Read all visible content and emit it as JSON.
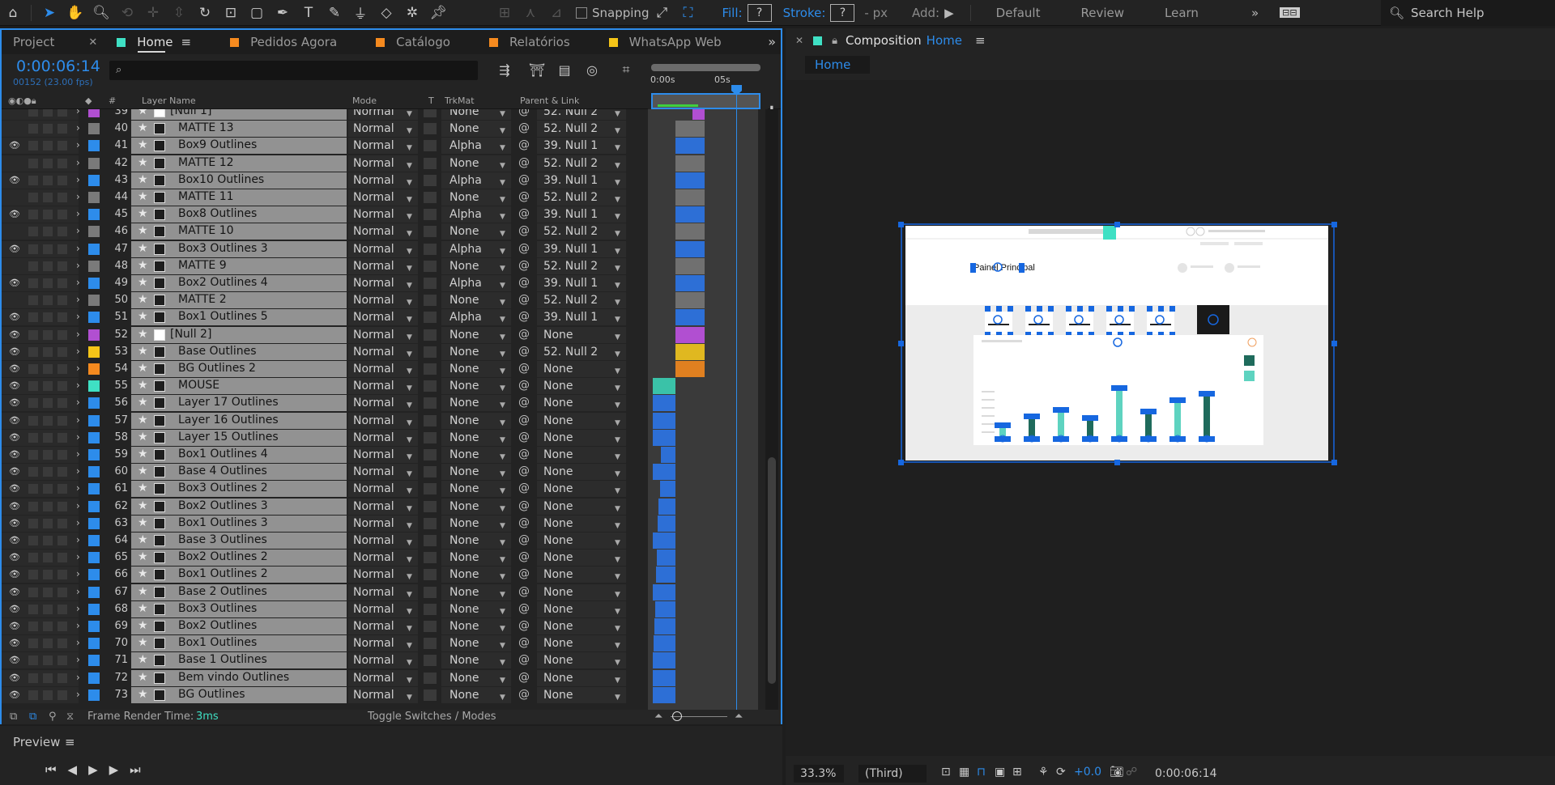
{
  "toolbar": {
    "snapping_label": "Snapping",
    "fill_label": "Fill:",
    "fill_value": "?",
    "stroke_label": "Stroke:",
    "stroke_value": "?",
    "stroke_unit": "- px",
    "add_label": "Add:",
    "workspaces": [
      "Default",
      "Review",
      "Learn"
    ],
    "search_placeholder": "Search Help"
  },
  "tabs": {
    "project": "Project",
    "home": "Home",
    "others": [
      {
        "label": "Pedidos Agora",
        "color": "#f58a1f"
      },
      {
        "label": "Catálogo",
        "color": "#f58a1f"
      },
      {
        "label": "Relatórios",
        "color": "#f58a1f"
      },
      {
        "label": "WhatsApp Web",
        "color": "#f5c518"
      }
    ],
    "home_color": "#3fe0c4"
  },
  "timeline": {
    "timecode": "0:00:06:14",
    "frames": "00152 (23.00 fps)",
    "ruler_start": "0:00s",
    "ruler_mark": "05s",
    "columns": {
      "name": "Layer Name",
      "mode": "Mode",
      "t": "T",
      "trkmat": "TrkMat",
      "parent": "Parent & Link",
      "num": "#"
    }
  },
  "layers": [
    {
      "num": "39",
      "name": "[Null 1]",
      "type": "null",
      "color": "#b14fd1",
      "mode": "Normal",
      "trk": "None",
      "parent": "52. Null 2",
      "eye": false,
      "bar": [
        55,
        70,
        "#b14fd1"
      ]
    },
    {
      "num": "40",
      "name": "MATTE 13",
      "type": "matte",
      "color": "#7a7a7a",
      "mode": "Normal",
      "trk": "None",
      "parent": "52. Null 2",
      "eye": false,
      "bar": [
        34,
        70,
        "#707070"
      ]
    },
    {
      "num": "41",
      "name": "Box9 Outlines",
      "type": "shape",
      "color": "#2d8ceb",
      "mode": "Normal",
      "trk": "Alpha",
      "parent": "39. Null 1",
      "eye": true,
      "bar": [
        34,
        70,
        "#2d6fd6"
      ]
    },
    {
      "num": "42",
      "name": "MATTE 12",
      "type": "matte",
      "color": "#7a7a7a",
      "mode": "Normal",
      "trk": "None",
      "parent": "52. Null 2",
      "eye": false,
      "bar": [
        34,
        70,
        "#707070"
      ]
    },
    {
      "num": "43",
      "name": "Box10 Outlines",
      "type": "shape",
      "color": "#2d8ceb",
      "mode": "Normal",
      "trk": "Alpha",
      "parent": "39. Null 1",
      "eye": true,
      "bar": [
        34,
        70,
        "#2d6fd6"
      ]
    },
    {
      "num": "44",
      "name": "MATTE 11",
      "type": "matte",
      "color": "#7a7a7a",
      "mode": "Normal",
      "trk": "None",
      "parent": "52. Null 2",
      "eye": false,
      "bar": [
        34,
        70,
        "#707070"
      ]
    },
    {
      "num": "45",
      "name": "Box8 Outlines",
      "type": "shape",
      "color": "#2d8ceb",
      "mode": "Normal",
      "trk": "Alpha",
      "parent": "39. Null 1",
      "eye": true,
      "bar": [
        34,
        70,
        "#2d6fd6"
      ]
    },
    {
      "num": "46",
      "name": "MATTE 10",
      "type": "matte",
      "color": "#7a7a7a",
      "mode": "Normal",
      "trk": "None",
      "parent": "52. Null 2",
      "eye": false,
      "bar": [
        34,
        70,
        "#707070"
      ]
    },
    {
      "num": "47",
      "name": "Box3 Outlines 3",
      "type": "shape",
      "color": "#2d8ceb",
      "mode": "Normal",
      "trk": "Alpha",
      "parent": "39. Null 1",
      "eye": true,
      "bar": [
        34,
        70,
        "#2d6fd6"
      ]
    },
    {
      "num": "48",
      "name": "MATTE 9",
      "type": "matte",
      "color": "#7a7a7a",
      "mode": "Normal",
      "trk": "None",
      "parent": "52. Null 2",
      "eye": false,
      "bar": [
        34,
        70,
        "#707070"
      ]
    },
    {
      "num": "49",
      "name": "Box2 Outlines 4",
      "type": "shape",
      "color": "#2d8ceb",
      "mode": "Normal",
      "trk": "Alpha",
      "parent": "39. Null 1",
      "eye": true,
      "bar": [
        34,
        70,
        "#2d6fd6"
      ]
    },
    {
      "num": "50",
      "name": "MATTE 2",
      "type": "matte",
      "color": "#7a7a7a",
      "mode": "Normal",
      "trk": "None",
      "parent": "52. Null 2",
      "eye": false,
      "bar": [
        34,
        70,
        "#707070"
      ]
    },
    {
      "num": "51",
      "name": "Box1 Outlines 5",
      "type": "shape",
      "color": "#2d8ceb",
      "mode": "Normal",
      "trk": "Alpha",
      "parent": "39. Null 1",
      "eye": true,
      "bar": [
        34,
        70,
        "#2d6fd6"
      ]
    },
    {
      "num": "52",
      "name": "[Null 2]",
      "type": "null",
      "color": "#b14fd1",
      "mode": "Normal",
      "trk": "None",
      "parent": "None",
      "eye": true,
      "bar": [
        34,
        70,
        "#b14fd1"
      ]
    },
    {
      "num": "53",
      "name": "Base Outlines",
      "type": "text",
      "color": "#f5c518",
      "mode": "Normal",
      "trk": "None",
      "parent": "52. Null 2",
      "eye": true,
      "bar": [
        34,
        70,
        "#e0b820"
      ]
    },
    {
      "num": "54",
      "name": "BG Outlines 2",
      "type": "text",
      "color": "#f58a1f",
      "mode": "Normal",
      "trk": "None",
      "parent": "None",
      "eye": true,
      "bar": [
        34,
        70,
        "#e08020"
      ]
    },
    {
      "num": "55",
      "name": "MOUSE",
      "type": "text",
      "color": "#3fe0c4",
      "mode": "Normal",
      "trk": "None",
      "parent": "None",
      "eye": true,
      "bar": [
        6,
        34,
        "#3ac2a8"
      ]
    },
    {
      "num": "56",
      "name": "Layer 17 Outlines",
      "type": "text",
      "color": "#2d8ceb",
      "mode": "Normal",
      "trk": "None",
      "parent": "None",
      "eye": true,
      "bar": [
        6,
        34,
        "#2d6fd6"
      ]
    },
    {
      "num": "57",
      "name": "Layer 16 Outlines",
      "type": "text",
      "color": "#2d8ceb",
      "mode": "Normal",
      "trk": "None",
      "parent": "None",
      "eye": true,
      "bar": [
        6,
        34,
        "#2d6fd6"
      ]
    },
    {
      "num": "58",
      "name": "Layer 15 Outlines",
      "type": "text",
      "color": "#2d8ceb",
      "mode": "Normal",
      "trk": "None",
      "parent": "None",
      "eye": true,
      "bar": [
        6,
        34,
        "#2d6fd6"
      ]
    },
    {
      "num": "59",
      "name": "Box1 Outlines 4",
      "type": "text",
      "color": "#2d8ceb",
      "mode": "Normal",
      "trk": "None",
      "parent": "None",
      "eye": true,
      "bar": [
        16,
        34,
        "#2d6fd6"
      ]
    },
    {
      "num": "60",
      "name": "Base 4 Outlines",
      "type": "text",
      "color": "#2d8ceb",
      "mode": "Normal",
      "trk": "None",
      "parent": "None",
      "eye": true,
      "bar": [
        6,
        34,
        "#2d6fd6"
      ]
    },
    {
      "num": "61",
      "name": "Box3 Outlines 2",
      "type": "text",
      "color": "#2d8ceb",
      "mode": "Normal",
      "trk": "None",
      "parent": "None",
      "eye": true,
      "bar": [
        15,
        34,
        "#2d6fd6"
      ]
    },
    {
      "num": "62",
      "name": "Box2 Outlines 3",
      "type": "text",
      "color": "#2d8ceb",
      "mode": "Normal",
      "trk": "None",
      "parent": "None",
      "eye": true,
      "bar": [
        13,
        34,
        "#2d6fd6"
      ]
    },
    {
      "num": "63",
      "name": "Box1 Outlines 3",
      "type": "text",
      "color": "#2d8ceb",
      "mode": "Normal",
      "trk": "None",
      "parent": "None",
      "eye": true,
      "bar": [
        12,
        34,
        "#2d6fd6"
      ]
    },
    {
      "num": "64",
      "name": "Base 3 Outlines",
      "type": "text",
      "color": "#2d8ceb",
      "mode": "Normal",
      "trk": "None",
      "parent": "None",
      "eye": true,
      "bar": [
        6,
        34,
        "#2d6fd6"
      ]
    },
    {
      "num": "65",
      "name": "Box2 Outlines 2",
      "type": "text",
      "color": "#2d8ceb",
      "mode": "Normal",
      "trk": "None",
      "parent": "None",
      "eye": true,
      "bar": [
        11,
        34,
        "#2d6fd6"
      ]
    },
    {
      "num": "66",
      "name": "Box1 Outlines 2",
      "type": "text",
      "color": "#2d8ceb",
      "mode": "Normal",
      "trk": "None",
      "parent": "None",
      "eye": true,
      "bar": [
        10,
        34,
        "#2d6fd6"
      ]
    },
    {
      "num": "67",
      "name": "Base 2 Outlines",
      "type": "text",
      "color": "#2d8ceb",
      "mode": "Normal",
      "trk": "None",
      "parent": "None",
      "eye": true,
      "bar": [
        6,
        34,
        "#2d6fd6"
      ]
    },
    {
      "num": "68",
      "name": "Box3 Outlines",
      "type": "text",
      "color": "#2d8ceb",
      "mode": "Normal",
      "trk": "None",
      "parent": "None",
      "eye": true,
      "bar": [
        9,
        34,
        "#2d6fd6"
      ]
    },
    {
      "num": "69",
      "name": "Box2 Outlines",
      "type": "text",
      "color": "#2d8ceb",
      "mode": "Normal",
      "trk": "None",
      "parent": "None",
      "eye": true,
      "bar": [
        8,
        34,
        "#2d6fd6"
      ]
    },
    {
      "num": "70",
      "name": "Box1 Outlines",
      "type": "text",
      "color": "#2d8ceb",
      "mode": "Normal",
      "trk": "None",
      "parent": "None",
      "eye": true,
      "bar": [
        7,
        34,
        "#2d6fd6"
      ]
    },
    {
      "num": "71",
      "name": "Base 1 Outlines",
      "type": "text",
      "color": "#2d8ceb",
      "mode": "Normal",
      "trk": "None",
      "parent": "None",
      "eye": true,
      "bar": [
        6,
        34,
        "#2d6fd6"
      ]
    },
    {
      "num": "72",
      "name": "Bem vindo Outlines",
      "type": "text",
      "color": "#2d8ceb",
      "mode": "Normal",
      "trk": "None",
      "parent": "None",
      "eye": true,
      "bar": [
        6,
        34,
        "#2d6fd6"
      ]
    },
    {
      "num": "73",
      "name": "BG Outlines",
      "type": "text",
      "color": "#2d8ceb",
      "mode": "Normal",
      "trk": "None",
      "parent": "None",
      "eye": true,
      "bar": [
        6,
        34,
        "#2d6fd6"
      ]
    }
  ],
  "timeline_footer": {
    "render_label": "Frame Render Time:",
    "render_value": "3ms",
    "toggle_label": "Toggle Switches / Modes"
  },
  "preview": {
    "title": "Preview"
  },
  "composition": {
    "tab_prefix": "Composition",
    "tab_name": "Home",
    "breadcrumb": "Home",
    "zoom": "33.3%",
    "resolution": "(Third)",
    "exposure": "+0.0",
    "timecode": "0:00:06:14",
    "frame_title": "Painel Principal"
  }
}
